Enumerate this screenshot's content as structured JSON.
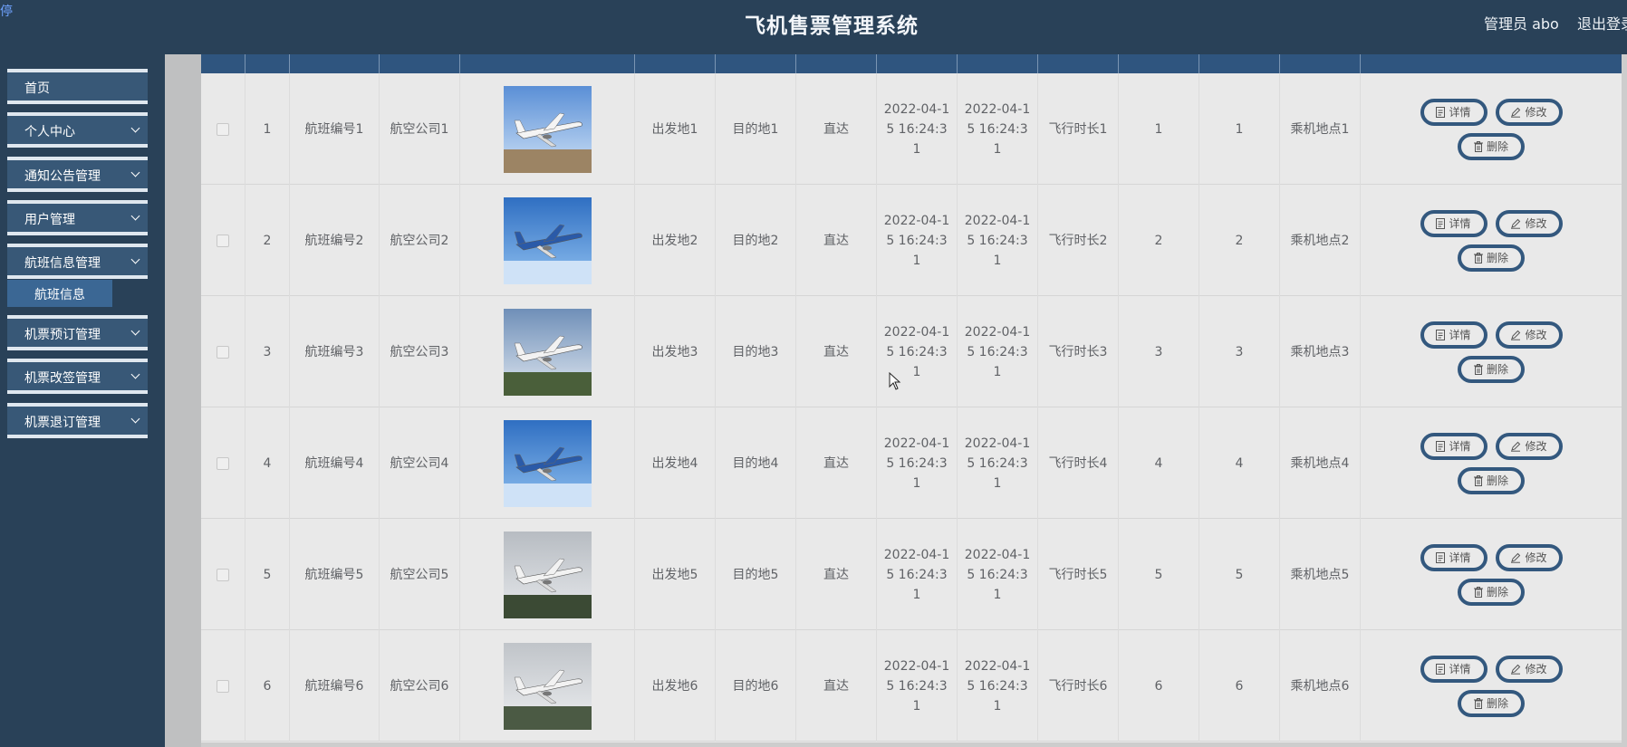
{
  "header": {
    "corner_glyph": "停",
    "title": "飞机售票管理系统",
    "user": "管理员 abo",
    "logout": "退出登录"
  },
  "sidebar": {
    "items": [
      {
        "label": "首页",
        "has_children": false
      },
      {
        "label": "个人中心",
        "has_children": true
      },
      {
        "label": "通知公告管理",
        "has_children": true
      },
      {
        "label": "用户管理",
        "has_children": true
      },
      {
        "label": "航班信息管理",
        "has_children": true
      },
      {
        "label": "机票预订管理",
        "has_children": true
      },
      {
        "label": "机票改签管理",
        "has_children": true
      },
      {
        "label": "机票退订管理",
        "has_children": true
      }
    ],
    "submenu": {
      "label": "航班信息"
    }
  },
  "actions": {
    "detail": "详情",
    "edit": "修改",
    "delete": "删除"
  },
  "rows": [
    {
      "no": "1",
      "flight": "航班编号1",
      "airline": "航空公司1",
      "image": "plane-photo-1",
      "from": "出发地1",
      "to": "目的地1",
      "type": "直达",
      "dep": "2022-04-15 16:24:31",
      "arr": "2022-04-15 16:24:31",
      "duration": "飞行时长1",
      "v1": "1",
      "v2": "1",
      "boarding": "乘机地点1"
    },
    {
      "no": "2",
      "flight": "航班编号2",
      "airline": "航空公司2",
      "image": "plane-photo-2",
      "from": "出发地2",
      "to": "目的地2",
      "type": "直达",
      "dep": "2022-04-15 16:24:31",
      "arr": "2022-04-15 16:24:31",
      "duration": "飞行时长2",
      "v1": "2",
      "v2": "2",
      "boarding": "乘机地点2"
    },
    {
      "no": "3",
      "flight": "航班编号3",
      "airline": "航空公司3",
      "image": "plane-photo-3",
      "from": "出发地3",
      "to": "目的地3",
      "type": "直达",
      "dep": "2022-04-15 16:24:31",
      "arr": "2022-04-15 16:24:31",
      "duration": "飞行时长3",
      "v1": "3",
      "v2": "3",
      "boarding": "乘机地点3"
    },
    {
      "no": "4",
      "flight": "航班编号4",
      "airline": "航空公司4",
      "image": "plane-photo-4",
      "from": "出发地4",
      "to": "目的地4",
      "type": "直达",
      "dep": "2022-04-15 16:24:31",
      "arr": "2022-04-15 16:24:31",
      "duration": "飞行时长4",
      "v1": "4",
      "v2": "4",
      "boarding": "乘机地点4"
    },
    {
      "no": "5",
      "flight": "航班编号5",
      "airline": "航空公司5",
      "image": "plane-photo-5",
      "from": "出发地5",
      "to": "目的地5",
      "type": "直达",
      "dep": "2022-04-15 16:24:31",
      "arr": "2022-04-15 16:24:31",
      "duration": "飞行时长5",
      "v1": "5",
      "v2": "5",
      "boarding": "乘机地点5"
    },
    {
      "no": "6",
      "flight": "航班编号6",
      "airline": "航空公司6",
      "image": "plane-photo-6",
      "from": "出发地6",
      "to": "目的地6",
      "type": "直达",
      "dep": "2022-04-15 16:24:31",
      "arr": "2022-04-15 16:24:31",
      "duration": "飞行时长6",
      "v1": "6",
      "v2": "6",
      "boarding": "乘机地点6"
    }
  ],
  "colors": {
    "header_bg": "#294158",
    "menu_bg": "#385877",
    "submenu_bg": "#3b6794",
    "table_header": "#2f557f",
    "button_border": "#33587e",
    "table_bg": "#e9e9e9"
  }
}
